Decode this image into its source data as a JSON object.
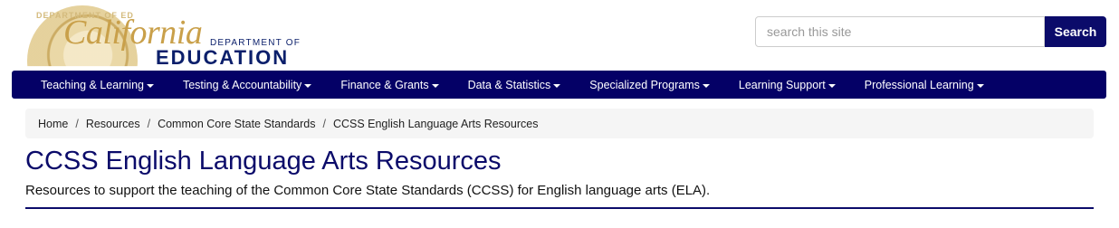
{
  "logo": {
    "script_word": "California",
    "dept_line": "DEPARTMENT OF",
    "edu_line": "EDUCATION",
    "seal_text": "DEPARTMENT OF ED"
  },
  "search": {
    "placeholder": "search this site",
    "value": "",
    "button_label": "Search"
  },
  "nav": {
    "items": [
      {
        "label": "Teaching & Learning"
      },
      {
        "label": "Testing & Accountability"
      },
      {
        "label": "Finance & Grants"
      },
      {
        "label": "Data & Statistics"
      },
      {
        "label": "Specialized Programs"
      },
      {
        "label": "Learning Support"
      },
      {
        "label": "Professional Learning"
      }
    ]
  },
  "breadcrumb": {
    "separator": "/",
    "items": [
      {
        "label": "Home"
      },
      {
        "label": "Resources"
      },
      {
        "label": "Common Core State Standards"
      }
    ],
    "current": "CCSS English Language Arts Resources"
  },
  "page": {
    "title": "CCSS English Language Arts Resources",
    "lead": "Resources to support the teaching of the Common Core State Standards (CCSS) for English language arts (ELA)."
  },
  "colors": {
    "brand_navy": "#040066",
    "title_navy": "#0b0b6a",
    "logo_gold": "#c9a04a"
  }
}
